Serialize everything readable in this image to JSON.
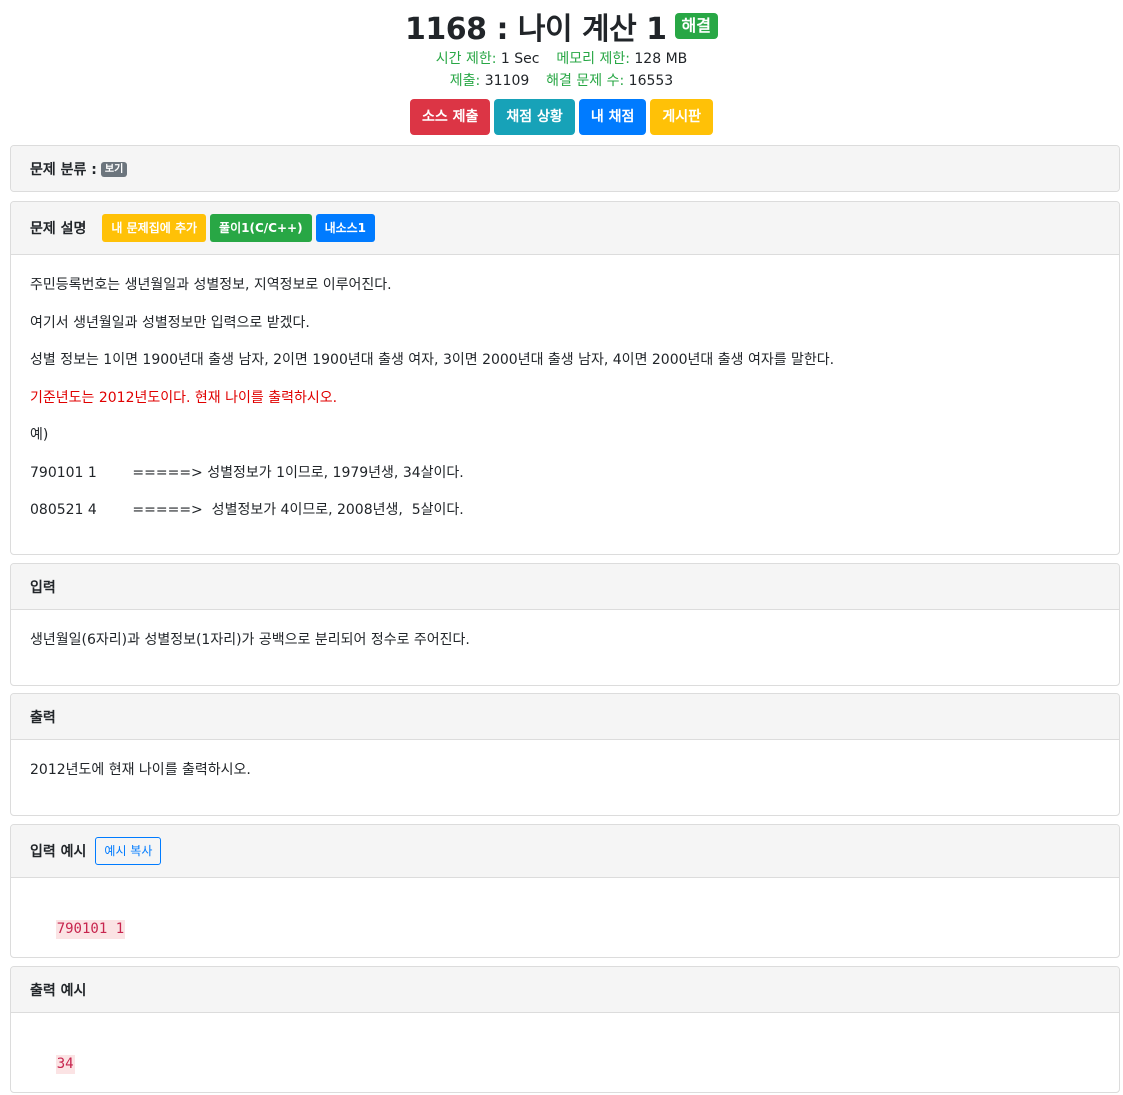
{
  "header": {
    "title": "1168 : 나이 계산 1",
    "solved_badge": "해결",
    "time_limit_label": "시간 제한:",
    "time_limit_value": "1 Sec",
    "memory_limit_label": "메모리 제한:",
    "memory_limit_value": "128 MB",
    "submissions_label": "제출:",
    "submissions_value": "31109",
    "solved_count_label": "해결 문제 수:",
    "solved_count_value": "16553"
  },
  "actions": {
    "submit": "소스 제출",
    "status": "채점 상황",
    "my_status": "내 채점",
    "board": "게시판"
  },
  "category": {
    "label": "문제 분류 :",
    "view_badge": "보기"
  },
  "description": {
    "title": "문제 설명",
    "add_to_set": "내 문제집에 추가",
    "solution": "풀이1(C/C++)",
    "my_source": "내소스1",
    "paragraphs": [
      "주민등록번호는 생년월일과 성별정보, 지역정보로 이루어진다.",
      "여기서 생년월일과 성별정보만 입력으로 받겠다.",
      "성별 정보는 1이면 1900년대 출생 남자, 2이면 1900년대 출생 여자, 3이면 2000년대 출생 남자, 4이면 2000년대 출생 여자를 말한다.",
      "기준년도는 2012년도이다. 현재 나이를 출력하시오.",
      "예)",
      "790101 1        =====> 성별정보가 1이므로, 1979년생, 34살이다.",
      "080521 4        =====>  성별정보가 4이므로, 2008년생,  5살이다."
    ]
  },
  "input": {
    "title": "입력",
    "text": "생년월일(6자리)과 성별정보(1자리)가 공백으로 분리되어 정수로 주어진다."
  },
  "output": {
    "title": "출력",
    "text": "2012년도에 현재 나이를 출력하시오."
  },
  "sample_input": {
    "title": "입력 예시",
    "copy_button": "예시 복사",
    "value": "790101 1"
  },
  "sample_output": {
    "title": "출력 예시",
    "value": "34"
  },
  "colors": {
    "green": "#28a745",
    "red": "#dc3545",
    "teal": "#17a2b8",
    "blue": "#007bff",
    "yellow": "#ffc107",
    "highlight_red": "#e00000"
  }
}
